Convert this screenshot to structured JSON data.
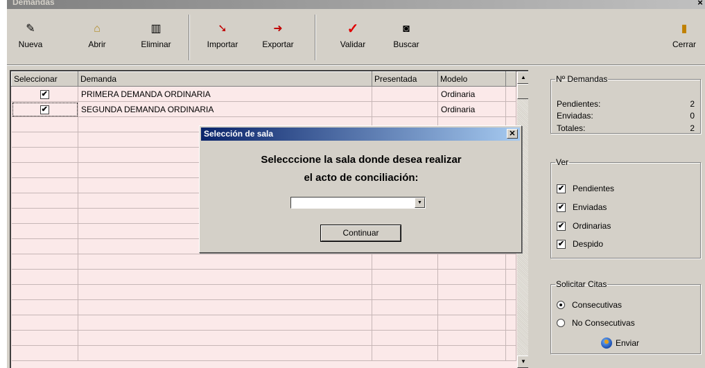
{
  "window": {
    "title": "Demandas",
    "close_glyph": "×"
  },
  "toolbar": {
    "buttons": [
      {
        "label": "Nueva",
        "icon": "new-doc-icon",
        "glyph": "✎"
      },
      {
        "label": "Abrir",
        "icon": "folder-open-icon",
        "glyph": "⌂"
      },
      {
        "label": "Eliminar",
        "icon": "trash-icon",
        "glyph": "▥"
      },
      {
        "label": "Importar",
        "icon": "import-icon",
        "glyph": "➘"
      },
      {
        "label": "Exportar",
        "icon": "export-icon",
        "glyph": "➜"
      },
      {
        "label": "Validar",
        "icon": "check-icon",
        "glyph": "✓"
      },
      {
        "label": "Buscar",
        "icon": "binoculars-icon",
        "glyph": "◙"
      },
      {
        "label": "Cerrar",
        "icon": "exit-door-icon",
        "glyph": "▮"
      }
    ]
  },
  "grid": {
    "columns": [
      "Seleccionar",
      "Demanda",
      "Presentada",
      "Modelo"
    ],
    "rows": [
      {
        "selected": true,
        "demanda": "PRIMERA DEMANDA ORDINARIA",
        "presentada": "",
        "modelo": "Ordinaria"
      },
      {
        "selected": true,
        "demanda": "SEGUNDA DEMANDA ORDINARIA",
        "presentada": "",
        "modelo": "Ordinaria"
      }
    ],
    "check_glyph": "✔",
    "empty_rows": 16
  },
  "stats": {
    "legend": "Nº Demandas",
    "pendientes_label": "Pendientes:",
    "pendientes_value": "2",
    "enviadas_label": "Enviadas:",
    "enviadas_value": "0",
    "totales_label": "Totales:",
    "totales_value": "2"
  },
  "ver": {
    "legend": "Ver",
    "items": [
      {
        "label": "Pendientes",
        "checked": true
      },
      {
        "label": "Enviadas",
        "checked": true
      },
      {
        "label": "Ordinarias",
        "checked": true
      },
      {
        "label": "Despido",
        "checked": true
      }
    ]
  },
  "citas": {
    "legend": "Solicitar Citas",
    "options": [
      {
        "label": "Consecutivas",
        "selected": true
      },
      {
        "label": "No Consecutivas",
        "selected": false
      }
    ],
    "send_label": "Enviar"
  },
  "dialog": {
    "title": "Selección de sala",
    "message_line1": "Selecccione la sala donde desea realizar",
    "message_line2": "el acto de conciliación:",
    "select_value": "",
    "continue_label": "Continuar",
    "close_glyph": "✕"
  }
}
